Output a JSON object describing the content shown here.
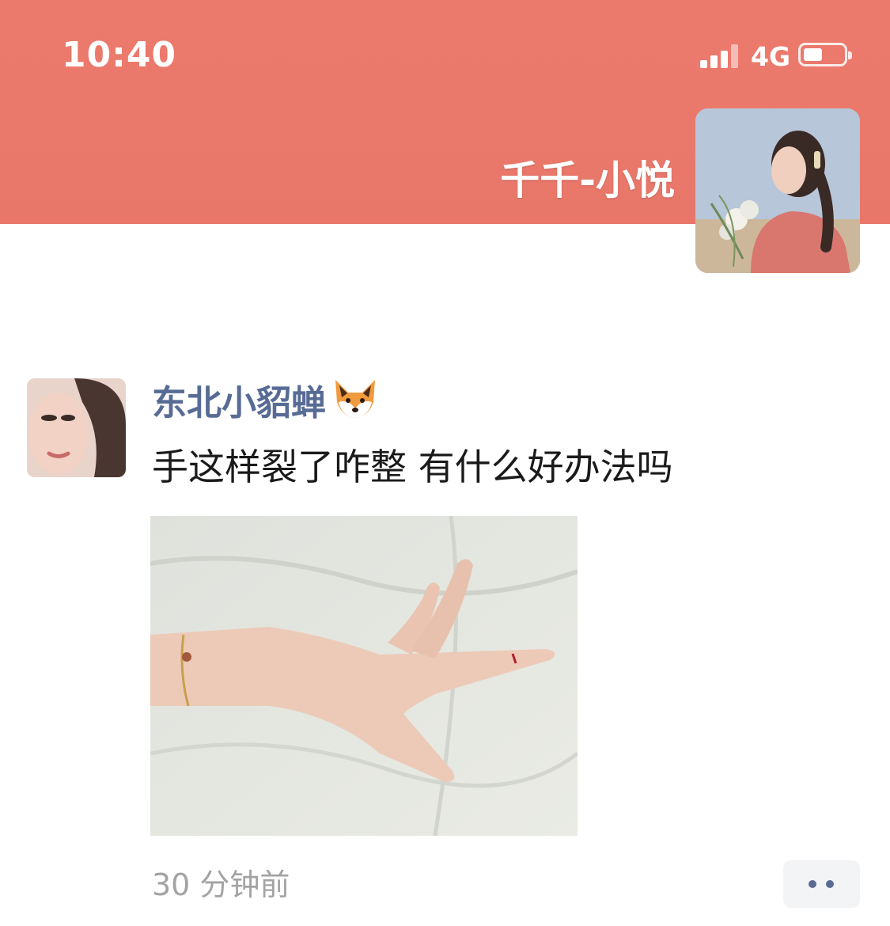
{
  "status_bar": {
    "time": "10:40",
    "network": "4G",
    "battery_level": 0.45
  },
  "cover": {
    "background_color": "#ec7a6c",
    "owner_name": "千千-小悦",
    "owner_avatar_icon": "profile-photo-woman-in-pink-sweater"
  },
  "post": {
    "author_name": "东北小貂蝉",
    "author_emoji": "fox-face-icon",
    "text": "手这样裂了咋整 有什么好办法吗",
    "image_icon": "photo-hand-with-cut-finger",
    "timestamp": "30 分钟前",
    "more_icon": "two-dots-icon",
    "name_color": "#576b95"
  }
}
